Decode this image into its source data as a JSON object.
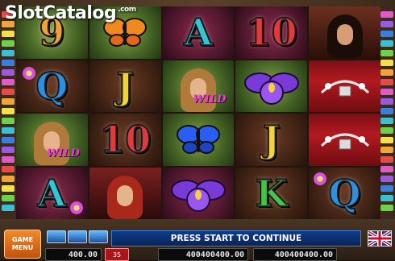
{
  "logo": {
    "brand": "SlotCatalog",
    "tld": ".com"
  },
  "reels": [
    [
      "9",
      "butterfly-orange",
      "A",
      "10",
      "portrait-dark"
    ],
    [
      "Q",
      "J",
      "portrait-blonde-wild",
      "iris-purple",
      "jewelry-red"
    ],
    [
      "portrait-blonde-wild",
      "10",
      "butterfly-blue",
      "J",
      "jewelry-red"
    ],
    [
      "A",
      "portrait-redhead",
      "iris-purple",
      "K",
      "Q"
    ]
  ],
  "wild_label": "WILD",
  "controls": {
    "game_menu_line1": "GAME",
    "game_menu_line2": "MENU",
    "status_message": "PRESS START TO CONTINUE",
    "bet_badge": "35",
    "counter_left": "400.00",
    "counter_mid": "400400400.00",
    "counter_right": "400400400.00"
  },
  "colors": {
    "status_bar": "#0f3c8a",
    "game_menu": "#f28a2a",
    "wild_text": "#e83ed5"
  }
}
